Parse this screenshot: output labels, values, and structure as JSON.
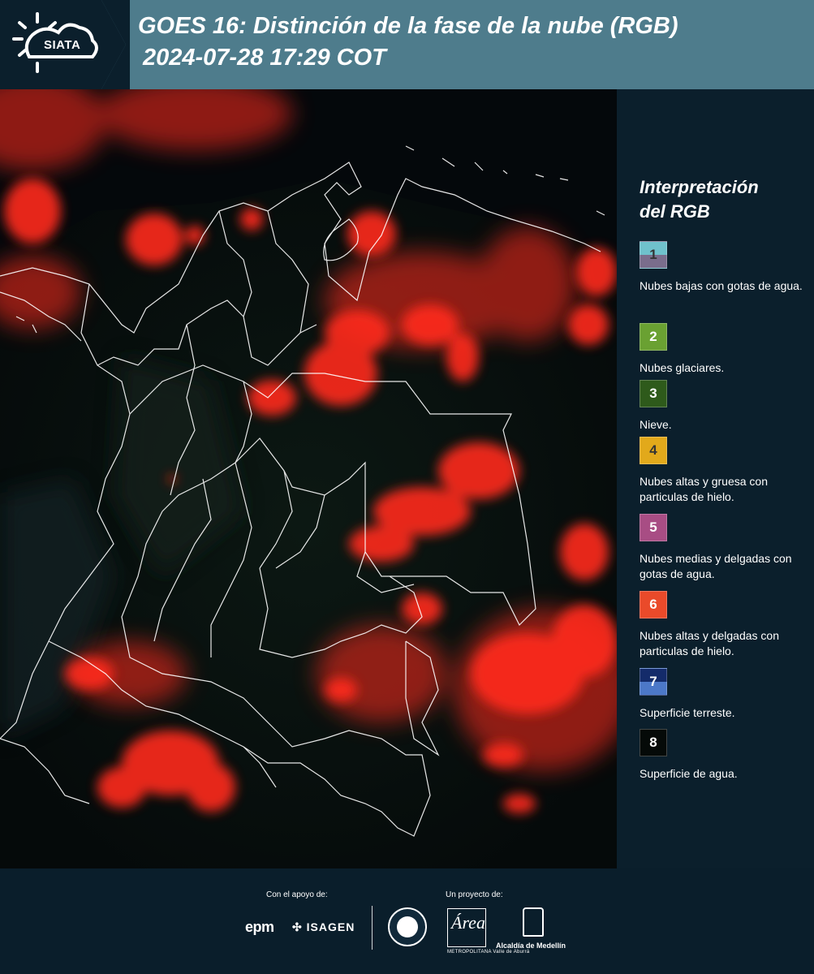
{
  "header": {
    "logo_text": "SIATA",
    "title_line1": "GOES 16: Distinción de la fase de la nube (RGB)",
    "title_line2": "2024-07-28 17:29 COT"
  },
  "legend": {
    "title_line1": "Interpretación",
    "title_line2": "del RGB",
    "items": [
      {
        "num": "1",
        "label": "Nubes bajas con gotas de agua.",
        "color_top": "#6fc1cc",
        "color_bottom": "#7a6d8c",
        "num_color": "#333333"
      },
      {
        "num": "2",
        "label": "Nubes glaciares.",
        "color_top": "#6aa132",
        "color_bottom": "#6aa132",
        "num_color": "#ffffff"
      },
      {
        "num": "3",
        "label": "Nieve.",
        "color_top": "#2e5a1b",
        "color_bottom": "#2e5a1b",
        "num_color": "#ffffff"
      },
      {
        "num": "4",
        "label": "Nubes altas y gruesa con particulas de hielo.",
        "color_top": "#e2a91b",
        "color_bottom": "#e2a91b",
        "num_color": "#333333"
      },
      {
        "num": "5",
        "label": "Nubes medias y delgadas con gotas de agua.",
        "color_top": "#a84d84",
        "color_bottom": "#a84d84",
        "num_color": "#ffffff"
      },
      {
        "num": "6",
        "label": "Nubes altas y delgadas con particulas de hielo.",
        "color_top": "#ea4a2a",
        "color_bottom": "#ea4a2a",
        "num_color": "#ffffff"
      },
      {
        "num": "7",
        "label": "Superficie terreste.",
        "color_top": "#142b6a",
        "color_bottom": "#4c78c8",
        "num_color": "#ffffff"
      },
      {
        "num": "8",
        "label": "Superficie de agua.",
        "color_top": "#050a08",
        "color_bottom": "#050a08",
        "num_color": "#ffffff"
      }
    ]
  },
  "footer": {
    "support_label": "Con el apoyo de:",
    "project_label": "Un proyecto de:",
    "epm": "epm",
    "isagen": "ISAGEN",
    "area_text": "Área",
    "area_sub": "METROPOLITANA Valle de Aburrá",
    "alcaldia": "Alcaldía de Medellín"
  },
  "colors": {
    "header_bg": "#4e7c8c",
    "panel_bg": "#0b1f2c",
    "cloud_red": "#ff2a1e",
    "boundary": "#ffffff"
  }
}
